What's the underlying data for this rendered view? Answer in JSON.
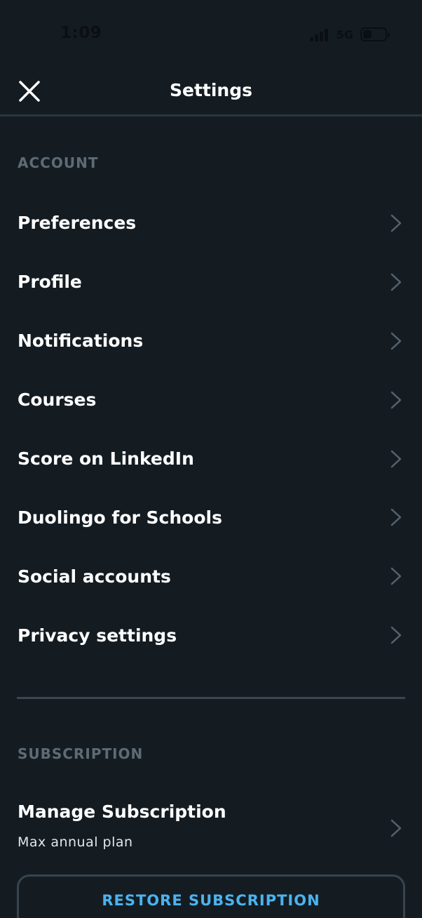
{
  "status_bar": {
    "time": "1:09",
    "network": "5G",
    "battery_level": 0.4
  },
  "header": {
    "title": "Settings",
    "close_icon": "close-icon"
  },
  "account": {
    "section_label": "ACCOUNT",
    "items": [
      {
        "label": "Preferences"
      },
      {
        "label": "Profile"
      },
      {
        "label": "Notifications"
      },
      {
        "label": "Courses"
      },
      {
        "label": "Score on LinkedIn"
      },
      {
        "label": "Duolingo for Schools"
      },
      {
        "label": "Social accounts"
      },
      {
        "label": "Privacy settings"
      }
    ]
  },
  "subscription": {
    "section_label": "SUBSCRIPTION",
    "manage_label": "Manage Subscription",
    "plan": "Max annual plan",
    "restore_label": "RESTORE SUBSCRIPTION"
  },
  "colors": {
    "background": "#141c22",
    "muted_label": "#5d6b75",
    "accent": "#4bb3ee",
    "divider": "#3a4650"
  }
}
